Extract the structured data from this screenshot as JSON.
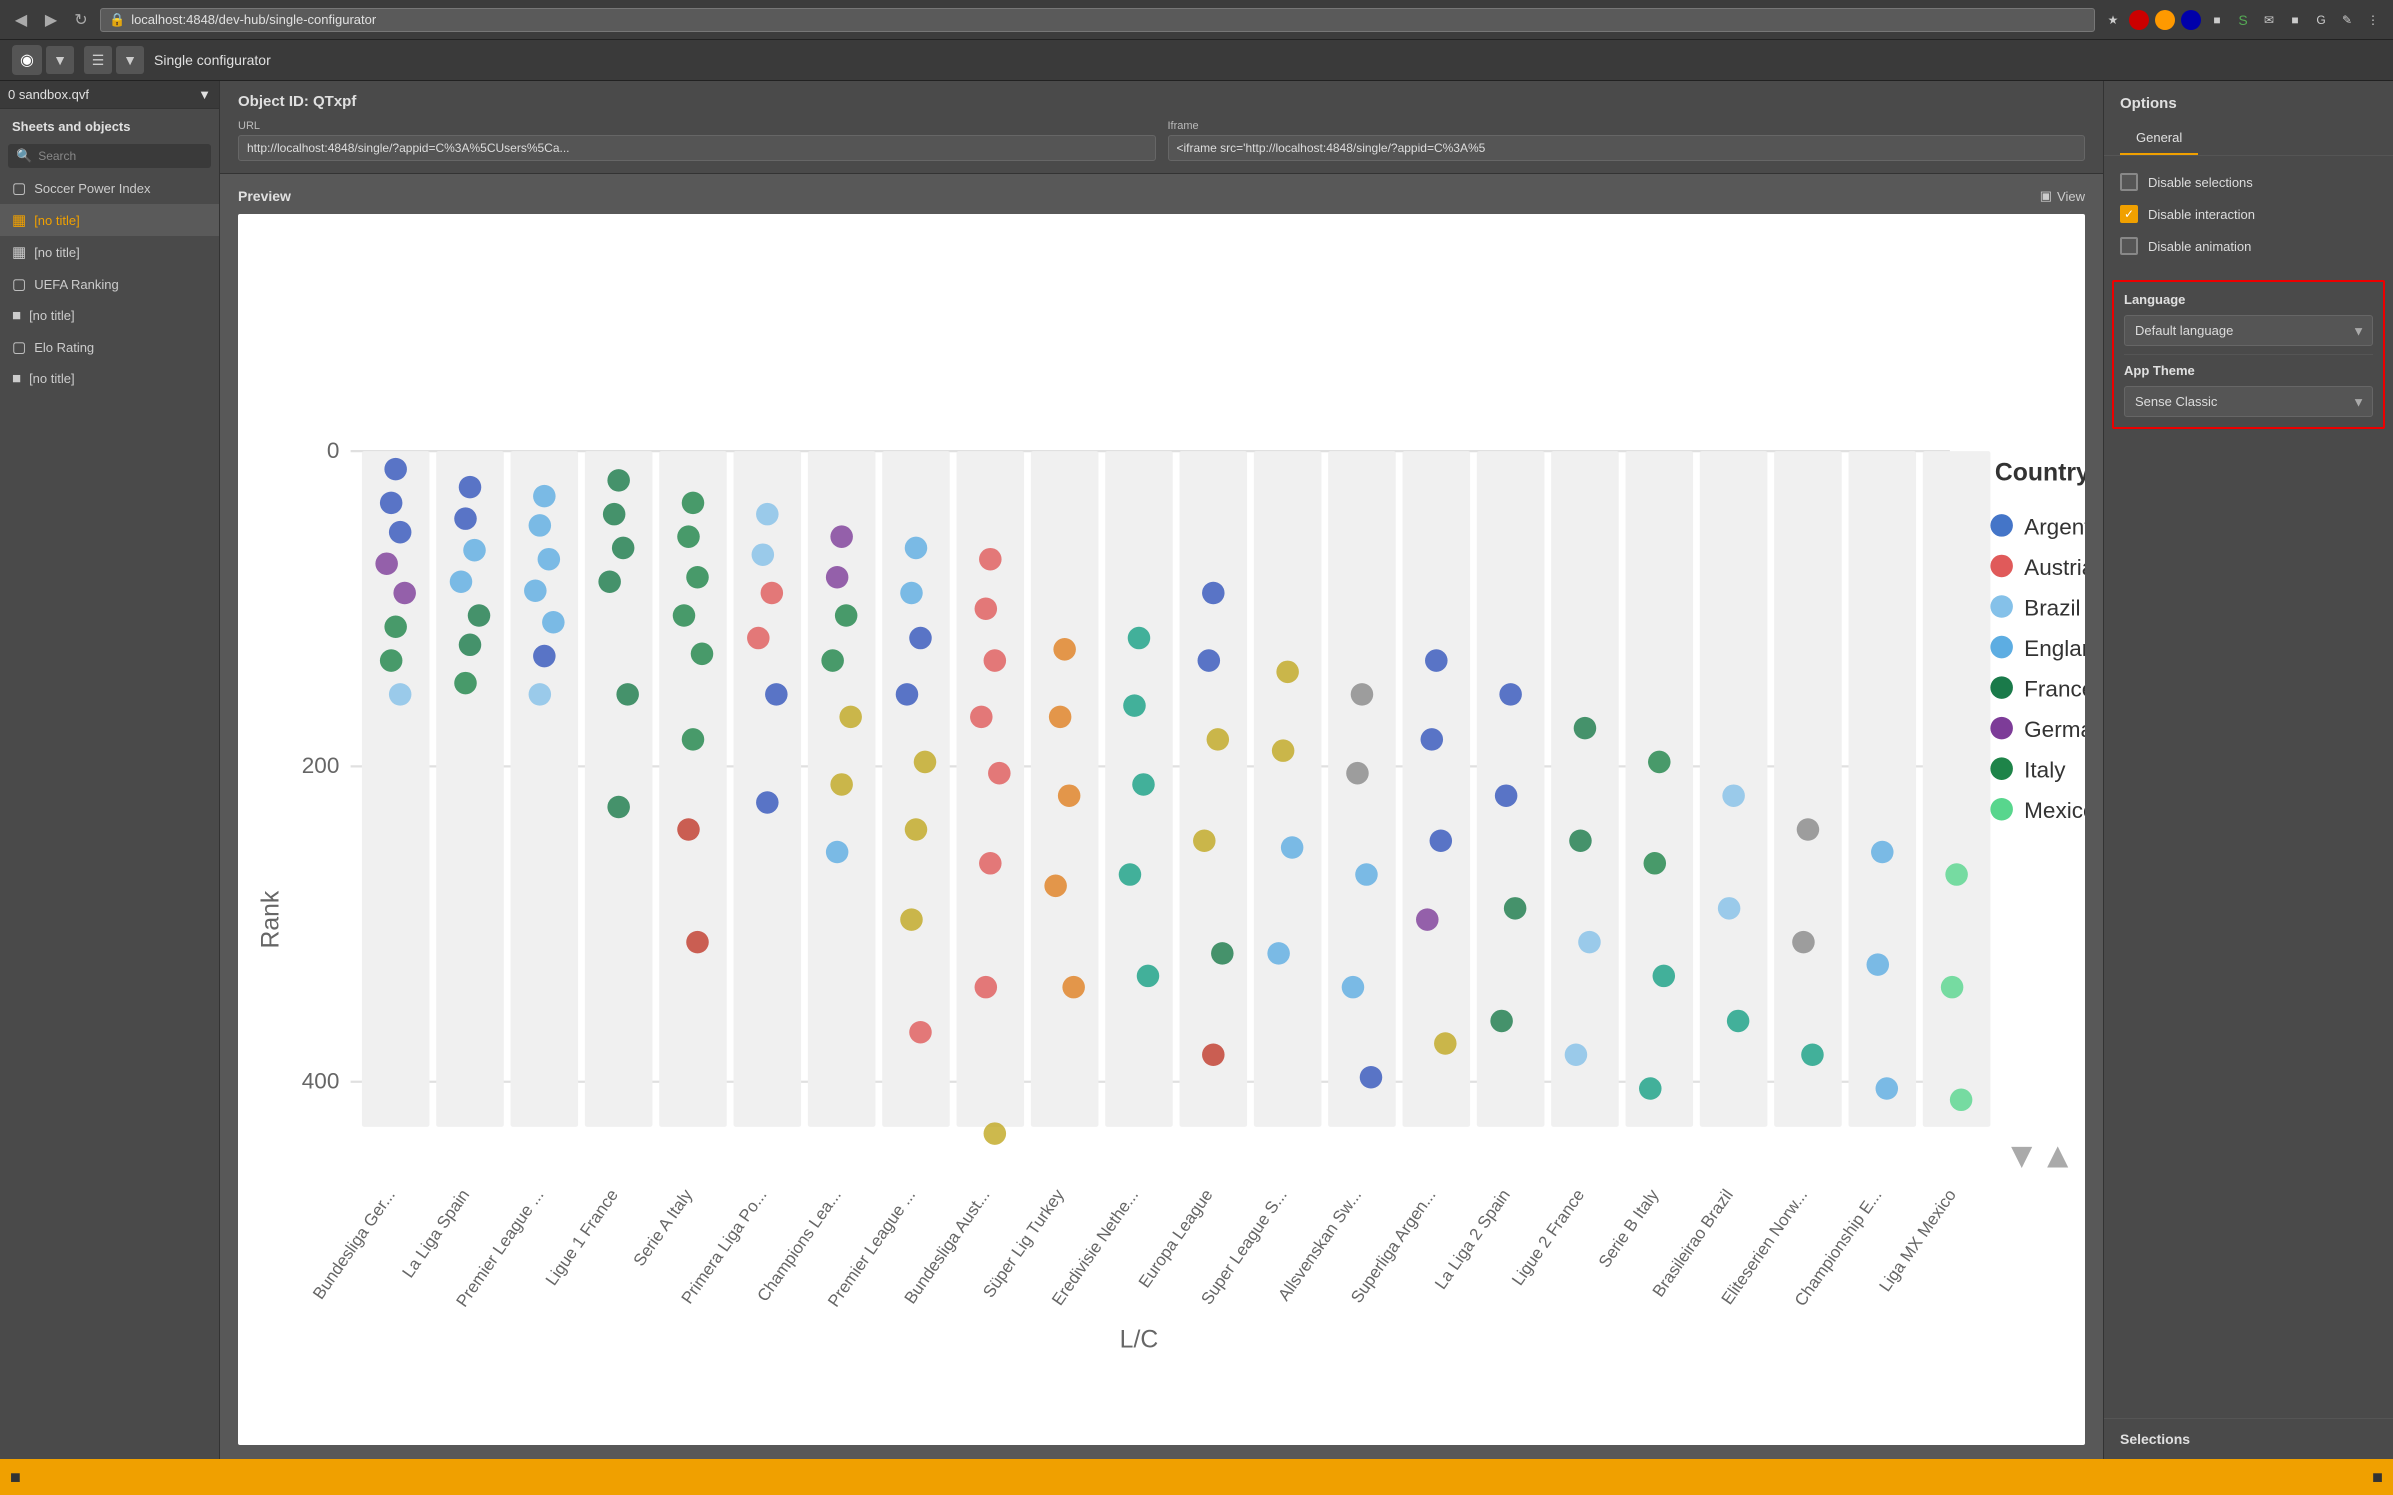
{
  "browser": {
    "url": "localhost:4848/dev-hub/single-configurator",
    "back_icon": "◀",
    "forward_icon": "▶",
    "refresh_icon": "↻"
  },
  "app_toolbar": {
    "title": "Single configurator",
    "logo_icon": "⊙"
  },
  "sidebar": {
    "app_selector": "0 sandbox.qvf",
    "section_title": "Sheets and objects",
    "search_placeholder": "Search",
    "items": [
      {
        "id": "soccer-power-index",
        "label": "Soccer Power Index",
        "icon": "⊞",
        "active": false
      },
      {
        "id": "no-title-1",
        "label": "[no title]",
        "icon": "▦",
        "active": true
      },
      {
        "id": "no-title-2",
        "label": "[no title]",
        "icon": "▦",
        "active": false
      },
      {
        "id": "uefa-ranking",
        "label": "UEFA Ranking",
        "icon": "⊞",
        "active": false
      },
      {
        "id": "no-title-3",
        "label": "[no title]",
        "icon": "⊟",
        "active": false
      },
      {
        "id": "elo-rating",
        "label": "Elo Rating",
        "icon": "⊞",
        "active": false
      },
      {
        "id": "no-title-4",
        "label": "[no title]",
        "icon": "⊟",
        "active": false
      }
    ]
  },
  "content": {
    "object_id_label": "Object ID: QTxpf",
    "url_label": "URL",
    "url_value": "http://localhost:4848/single/?appid=C%3A%5CUsers%5Ca...",
    "iframe_label": "Iframe",
    "iframe_value": "<iframe src='http://localhost:4848/single/?appid=C%3A%5",
    "preview_label": "Preview",
    "view_button": "View"
  },
  "chart": {
    "title": "Country",
    "y_label": "Rank",
    "x_label": "L/C",
    "y_ticks": [
      0,
      200,
      400
    ],
    "legend": [
      {
        "country": "Argentina",
        "color": "#4475c8"
      },
      {
        "country": "Austria",
        "color": "#e05a5a"
      },
      {
        "country": "Brazil",
        "color": "#85c1e9"
      },
      {
        "country": "England",
        "color": "#5dade2"
      },
      {
        "country": "France",
        "color": "#1a7a4a"
      },
      {
        "country": "Germany",
        "color": "#7d3c98"
      },
      {
        "country": "Italy",
        "color": "#1e8449"
      },
      {
        "country": "Mexico",
        "color": "#58d68d"
      }
    ],
    "x_categories": [
      "Bundesliga Ger...",
      "La Liga Spain",
      "Premier League ...",
      "Ligue 1 France",
      "Serie A Italy",
      "Primera Liga Po...",
      "Champions Lea...",
      "Premier League ...",
      "Bundesliga Aust...",
      "Süper Lig Turkey",
      "Eredivisie Nethe...",
      "Europa League",
      "Super League S...",
      "Allsvenskan Sw...",
      "Superliga Argen...",
      "La Liga 2 Spain",
      "Ligue 2 France",
      "Serie B Italy",
      "Brasileirao Brazil",
      "Eliteserien Norw...",
      "Championship E...",
      "Liga MX Mexico"
    ]
  },
  "options": {
    "title": "Options",
    "tab_general": "General",
    "disable_selections_label": "Disable selections",
    "disable_selections_checked": false,
    "disable_interaction_label": "Disable interaction",
    "disable_interaction_checked": true,
    "disable_animation_label": "Disable animation",
    "disable_animation_checked": false,
    "language_section_label": "Language",
    "language_options": [
      "Default language"
    ],
    "language_selected": "Default language",
    "app_theme_label": "App Theme",
    "app_theme_options": [
      "Sense Classic"
    ],
    "app_theme_selected": "Sense Classic"
  },
  "selections": {
    "title": "Selections"
  },
  "bottom_bar": {
    "icon": "■"
  }
}
